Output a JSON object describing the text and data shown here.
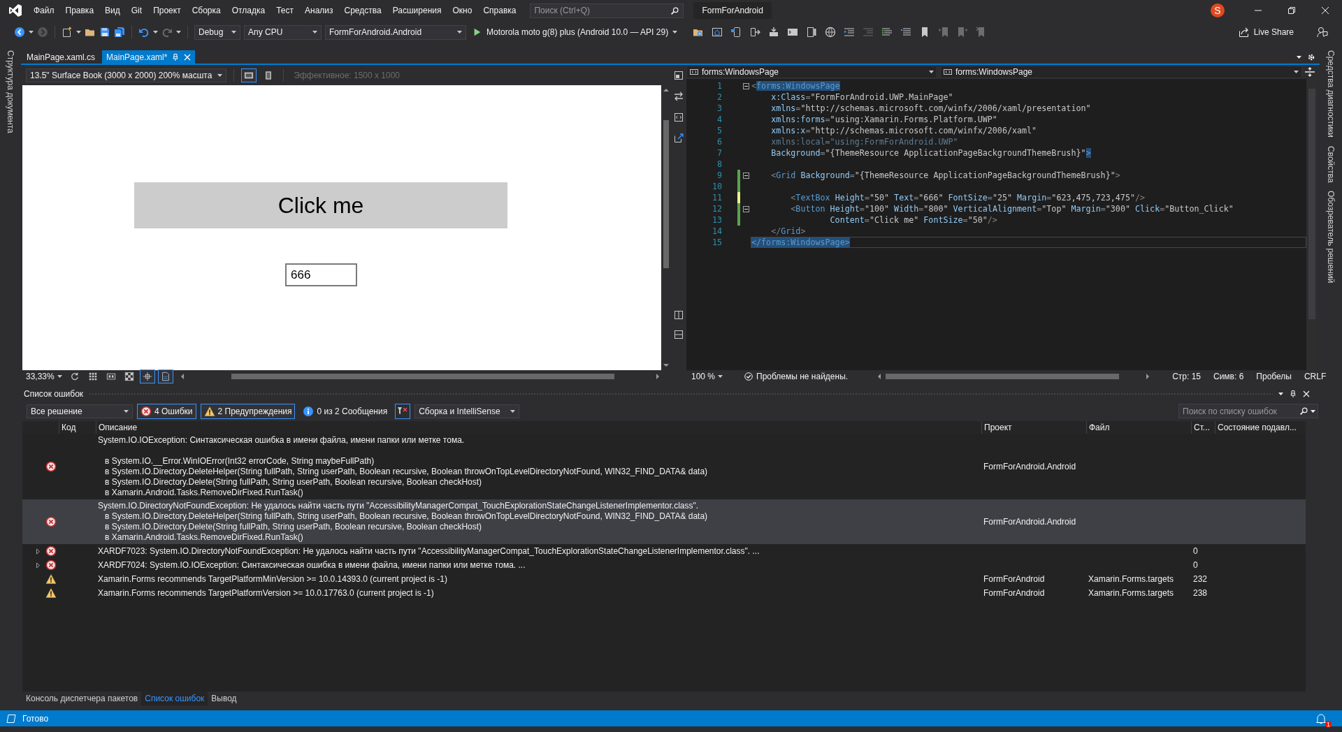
{
  "window": {
    "title": "FormForAndroid",
    "account": "S"
  },
  "menu": [
    "Файл",
    "Правка",
    "Вид",
    "Git",
    "Проект",
    "Сборка",
    "Отладка",
    "Тест",
    "Анализ",
    "Средства",
    "Расширения",
    "Окно",
    "Справка"
  ],
  "search": {
    "placeholder": "Поиск (Ctrl+Q)"
  },
  "toolbar": {
    "configuration": "Debug",
    "platform": "Any CPU",
    "startup_project": "FormForAndroid.Android",
    "run_target": "Motorola moto g(8) plus (Android 10.0 — API 29)",
    "live_share": "Live Share"
  },
  "left_strip": [
    "Структура документа"
  ],
  "right_strip": [
    "Средства диагностики",
    "Свойства",
    "Обозреватель решений"
  ],
  "document_tabs": [
    {
      "label": "MainPage.xaml.cs",
      "selected": false
    },
    {
      "label": "MainPage.xaml*",
      "selected": true
    }
  ],
  "designer": {
    "device": "13.5\" Surface Book (3000 x 2000) 200% масшта",
    "orientations": [
      {
        "kind": "landscape",
        "selected": true
      },
      {
        "kind": "portrait",
        "selected": false
      }
    ],
    "effective_size": "Эффективное: 1500 x 1000",
    "canvas": {
      "button": "Click me",
      "textbox": "666"
    },
    "zoom": "33,33%",
    "tools": [
      {
        "kind": "refresh",
        "on": false
      },
      {
        "kind": "grid",
        "on": false
      },
      {
        "kind": "layout",
        "on": false
      },
      {
        "kind": "checker",
        "on": false
      },
      {
        "kind": "snap_lines",
        "on": true
      },
      {
        "kind": "snap_grid",
        "on": true
      }
    ]
  },
  "editor": {
    "navigation": [
      "forms:WindowsPage",
      "forms:WindowsPage"
    ],
    "lines": [
      {
        "number": "1",
        "fold": true,
        "current": false,
        "tokens": [
          {
            "kind": "punct",
            "text": "<"
          },
          {
            "kind": "match",
            "text": "forms:WindowsPage"
          }
        ]
      },
      {
        "number": "2",
        "fold": false,
        "current": false,
        "tokens": [
          {
            "kind": "attr",
            "text": "    x:Class"
          },
          {
            "kind": "punct",
            "text": "="
          },
          {
            "kind": "value",
            "text": "\"FormForAndroid.UWP.MainPage\""
          }
        ]
      },
      {
        "number": "3",
        "fold": false,
        "current": false,
        "tokens": [
          {
            "kind": "attr",
            "text": "    xmlns"
          },
          {
            "kind": "punct",
            "text": "="
          },
          {
            "kind": "value",
            "text": "\"http://schemas.microsoft.com/winfx/2006/xaml/presentation\""
          }
        ]
      },
      {
        "number": "4",
        "fold": false,
        "current": false,
        "tokens": [
          {
            "kind": "attr",
            "text": "    xmlns:forms"
          },
          {
            "kind": "punct",
            "text": "="
          },
          {
            "kind": "value",
            "text": "\"using:Xamarin.Forms.Platform.UWP\""
          }
        ]
      },
      {
        "number": "5",
        "fold": false,
        "current": false,
        "tokens": [
          {
            "kind": "attr",
            "text": "    xmlns:x"
          },
          {
            "kind": "punct",
            "text": "="
          },
          {
            "kind": "value",
            "text": "\"http://schemas.microsoft.com/winfx/2006/xaml\""
          }
        ]
      },
      {
        "number": "6",
        "fold": false,
        "current": false,
        "tokens": [
          {
            "kind": "dim",
            "text": "    xmlns:local=\"using:FormForAndroid.UWP\""
          }
        ]
      },
      {
        "number": "7",
        "fold": false,
        "current": false,
        "tokens": [
          {
            "kind": "attr",
            "text": "    Background"
          },
          {
            "kind": "punct",
            "text": "="
          },
          {
            "kind": "value",
            "text": "\"{ThemeResource ApplicationPageBackgroundThemeBrush}\""
          },
          {
            "kind": "match",
            "text": ">"
          }
        ]
      },
      {
        "number": "8",
        "fold": false,
        "current": false
      },
      {
        "number": "9",
        "fold": true,
        "color": "#57a64a",
        "current": false,
        "tokens": [
          {
            "kind": "punct",
            "text": "    <"
          },
          {
            "kind": "tag",
            "text": "Grid"
          },
          {
            "kind": "attr",
            "text": " Background"
          },
          {
            "kind": "punct",
            "text": "="
          },
          {
            "kind": "value",
            "text": "\"{ThemeResource ApplicationPageBackgroundThemeBrush}\""
          },
          {
            "kind": "punct",
            "text": ">"
          }
        ]
      },
      {
        "number": "10",
        "fold": false,
        "color": "#57a64a",
        "current": false
      },
      {
        "number": "11",
        "fold": false,
        "color": "#efef91",
        "current": false,
        "tokens": [
          {
            "kind": "punct",
            "text": "        <"
          },
          {
            "kind": "tag",
            "text": "TextBox"
          },
          {
            "kind": "attr",
            "text": " Height"
          },
          {
            "kind": "punct",
            "text": "="
          },
          {
            "kind": "value",
            "text": "\"50\""
          },
          {
            "kind": "attr",
            "text": " Text"
          },
          {
            "kind": "punct",
            "text": "="
          },
          {
            "kind": "value",
            "text": "\"666\""
          },
          {
            "kind": "attr",
            "text": " FontSize"
          },
          {
            "kind": "punct",
            "text": "="
          },
          {
            "kind": "value",
            "text": "\"25\""
          },
          {
            "kind": "attr",
            "text": " Margin"
          },
          {
            "kind": "punct",
            "text": "="
          },
          {
            "kind": "value",
            "text": "\"623,475,723,475\""
          },
          {
            "kind": "punct",
            "text": "/>"
          }
        ]
      },
      {
        "number": "12",
        "fold": true,
        "color": "#57a64a",
        "current": false,
        "tokens": [
          {
            "kind": "punct",
            "text": "        <"
          },
          {
            "kind": "tag",
            "text": "Button"
          },
          {
            "kind": "attr",
            "text": " Height"
          },
          {
            "kind": "punct",
            "text": "="
          },
          {
            "kind": "value",
            "text": "\"100\""
          },
          {
            "kind": "attr",
            "text": " Width"
          },
          {
            "kind": "punct",
            "text": "="
          },
          {
            "kind": "value",
            "text": "\"800\""
          },
          {
            "kind": "attr",
            "text": " VerticalAlignment"
          },
          {
            "kind": "punct",
            "text": "="
          },
          {
            "kind": "value",
            "text": "\"Top\""
          },
          {
            "kind": "attr",
            "text": " Margin"
          },
          {
            "kind": "punct",
            "text": "="
          },
          {
            "kind": "value",
            "text": "\"300\""
          },
          {
            "kind": "attr",
            "text": " Click"
          },
          {
            "kind": "punct",
            "text": "="
          },
          {
            "kind": "value",
            "text": "\"Button_Click\""
          }
        ]
      },
      {
        "number": "13",
        "fold": false,
        "color": "#57a64a",
        "current": false,
        "tokens": [
          {
            "kind": "attr",
            "text": "                Content"
          },
          {
            "kind": "punct",
            "text": "="
          },
          {
            "kind": "value",
            "text": "\"Click me\""
          },
          {
            "kind": "attr",
            "text": " FontSize"
          },
          {
            "kind": "punct",
            "text": "="
          },
          {
            "kind": "value",
            "text": "\"50\""
          },
          {
            "kind": "punct",
            "text": "/>"
          }
        ]
      },
      {
        "number": "14",
        "fold": false,
        "current": false,
        "tokens": [
          {
            "kind": "punct",
            "text": "    </"
          },
          {
            "kind": "tag",
            "text": "Grid"
          },
          {
            "kind": "punct",
            "text": ">"
          }
        ]
      },
      {
        "number": "15",
        "fold": false,
        "current": true,
        "tokens": [
          {
            "kind": "match",
            "text": "</forms:WindowsPage>"
          }
        ]
      }
    ],
    "zoom": "100 %",
    "issues": "Проблемы не найдены.",
    "line": "Стр: 15",
    "column": "Симв: 6",
    "whitespace": "Пробелы",
    "line_endings": "CRLF"
  },
  "error_list": {
    "title": "Список ошибок",
    "scope": "Все решение",
    "filters": [
      {
        "kind": "error",
        "label": "4 Ошибки",
        "on": true
      },
      {
        "kind": "warning",
        "label": "2 Предупреждения",
        "on": true
      },
      {
        "kind": "message",
        "label": "0 из 2 Сообщения",
        "on": false
      }
    ],
    "filter_button": {
      "on": true
    },
    "source": "Сборка и IntelliSense",
    "search": {
      "placeholder": "Поиск по списку ошибок"
    },
    "columns": [
      "Код",
      "Описание",
      "Проект",
      "Файл",
      "Ст...",
      "Состояние подавл..."
    ],
    "rows": [
      {
        "kind": "error",
        "expandable": false,
        "selected": false,
        "description": "System.IO.IOException: Синтаксическая ошибка в имени файла, имени папки или метке тома.\n\n   в System.IO.__Error.WinIOError(Int32 errorCode, String maybeFullPath)\n   в System.IO.Directory.DeleteHelper(String fullPath, String userPath, Boolean recursive, Boolean throwOnTopLevelDirectoryNotFound, WIN32_FIND_DATA& data)\n   в System.IO.Directory.Delete(String fullPath, String userPath, Boolean recursive, Boolean checkHost)\n   в Xamarin.Android.Tasks.RemoveDirFixed.RunTask()",
        "project": "FormForAndroid.Android"
      },
      {
        "kind": "error",
        "expandable": false,
        "selected": true,
        "description": "System.IO.DirectoryNotFoundException: Не удалось найти часть пути \"AccessibilityManagerCompat_TouchExplorationStateChangeListenerImplementor.class\".\n   в System.IO.Directory.DeleteHelper(String fullPath, String userPath, Boolean recursive, Boolean throwOnTopLevelDirectoryNotFound, WIN32_FIND_DATA& data)\n   в System.IO.Directory.Delete(String fullPath, String userPath, Boolean recursive, Boolean checkHost)\n   в Xamarin.Android.Tasks.RemoveDirFixed.RunTask()",
        "project": "FormForAndroid.Android"
      },
      {
        "kind": "error",
        "expandable": true,
        "selected": false,
        "description": "XARDF7023: System.IO.DirectoryNotFoundException: Не удалось найти часть пути \"AccessibilityManagerCompat_TouchExplorationStateChangeListenerImplementor.class\". ...",
        "line": "0"
      },
      {
        "kind": "error",
        "expandable": true,
        "selected": false,
        "description": "XARDF7024: System.IO.IOException: Синтаксическая ошибка в имени файла, имени папки или метке тома. ...",
        "line": "0"
      },
      {
        "kind": "warning",
        "expandable": false,
        "selected": false,
        "description": "Xamarin.Forms recommends TargetPlatformMinVersion >= 10.0.14393.0 (current project is -1)",
        "project": "FormForAndroid",
        "file": "Xamarin.Forms.targets",
        "line": "232"
      },
      {
        "kind": "warning",
        "expandable": false,
        "selected": false,
        "description": "Xamarin.Forms recommends TargetPlatformVersion >= 10.0.17763.0 (current project is -1)",
        "project": "FormForAndroid",
        "file": "Xamarin.Forms.targets",
        "line": "238"
      }
    ]
  },
  "bottom_tabs": [
    {
      "label": "Консоль диспетчера пакетов",
      "selected": false
    },
    {
      "label": "Список ошибок",
      "selected": true
    },
    {
      "label": "Вывод",
      "selected": false
    }
  ],
  "status_bar": {
    "text": "Готово",
    "notifications": "1"
  }
}
